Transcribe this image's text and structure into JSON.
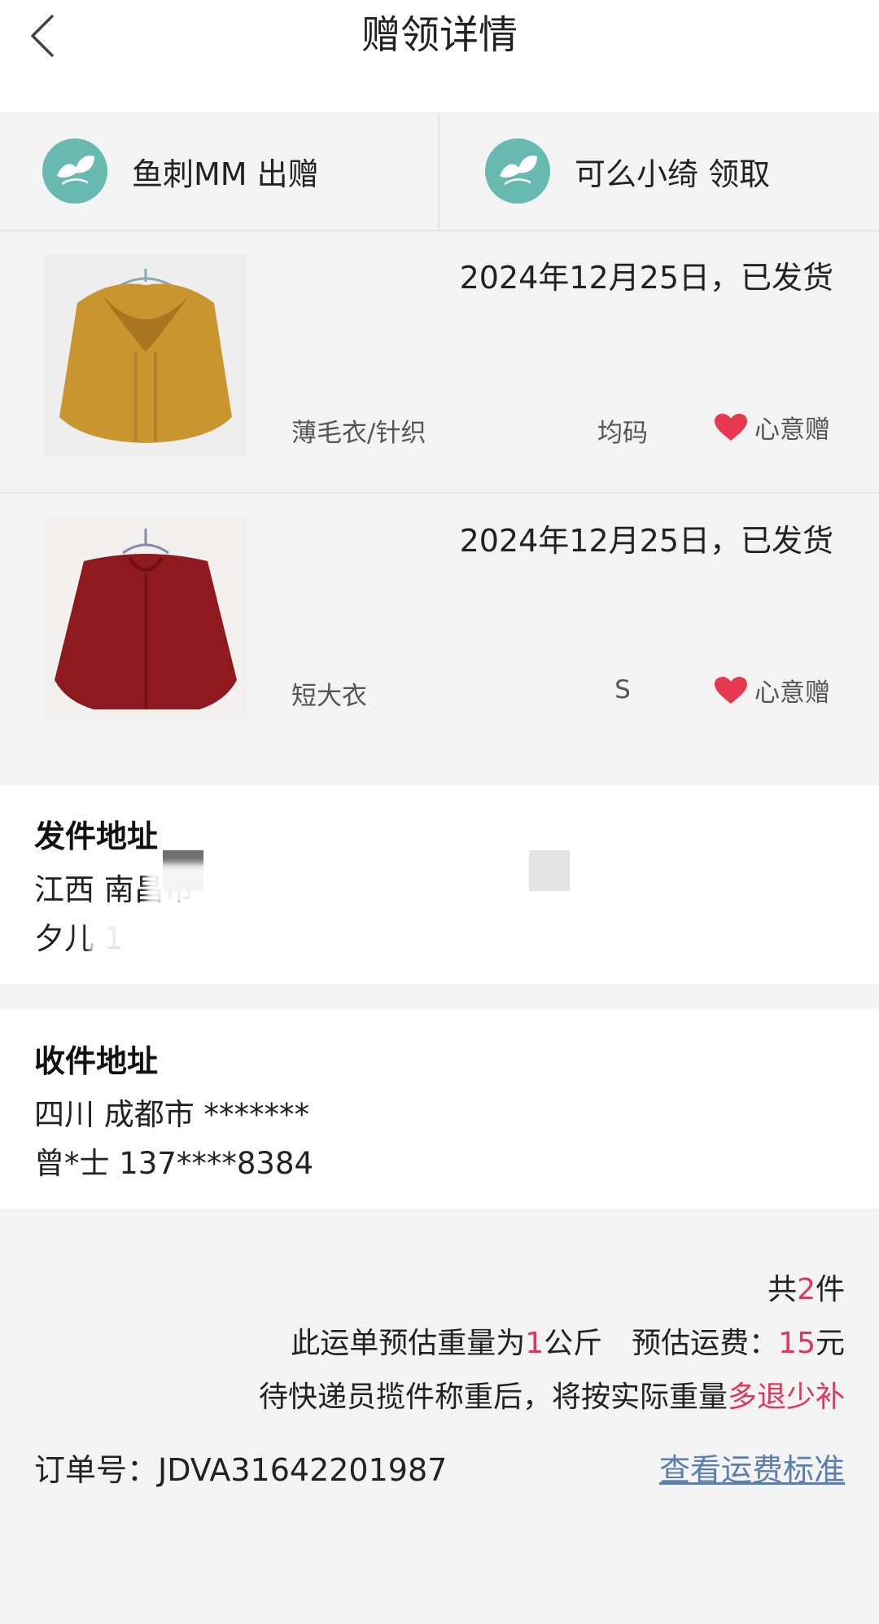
{
  "header": {
    "title": "赠领详情"
  },
  "parties": {
    "giver": {
      "name": "鱼刺MM",
      "action": "出赠",
      "text": "鱼刺MM 出赠"
    },
    "receiver": {
      "name": "可么小绮",
      "action": "领取",
      "text": "可么小绮 领取"
    }
  },
  "items": [
    {
      "date_status": "2024年12月25日，已发货",
      "category": "薄毛衣/针织",
      "size": "均码",
      "badge": "心意赠",
      "image_color": "#c8952e"
    },
    {
      "date_status": "2024年12月25日，已发货",
      "category": "短大衣",
      "size": "S",
      "badge": "心意赠",
      "image_color": "#8e1a1f"
    }
  ],
  "sender_address": {
    "title": "发件地址",
    "line1": "江西 南昌市",
    "line2": "夕儿 1"
  },
  "receiver_address": {
    "title": "收件地址",
    "line1": "四川 成都市 *******",
    "line2": "曾*士 137****8384"
  },
  "summary": {
    "count_prefix": "共",
    "count": "2",
    "count_suffix": "件",
    "weight_prefix": "此运单预估重量为",
    "weight": "1",
    "weight_suffix": "公斤　预估运费：",
    "fee": "15",
    "fee_suffix": "元",
    "note_prefix": "待快递员揽件称重后，将按实际重量",
    "note_highlight": "多退少补"
  },
  "order": {
    "label": "订单号：JDVA31642201987",
    "link": "查看运费标准"
  },
  "colors": {
    "accent_red": "#e0375e",
    "link_blue": "#5a7fae",
    "avatar_teal": "#68bab1",
    "heart_red": "#e8384f"
  }
}
